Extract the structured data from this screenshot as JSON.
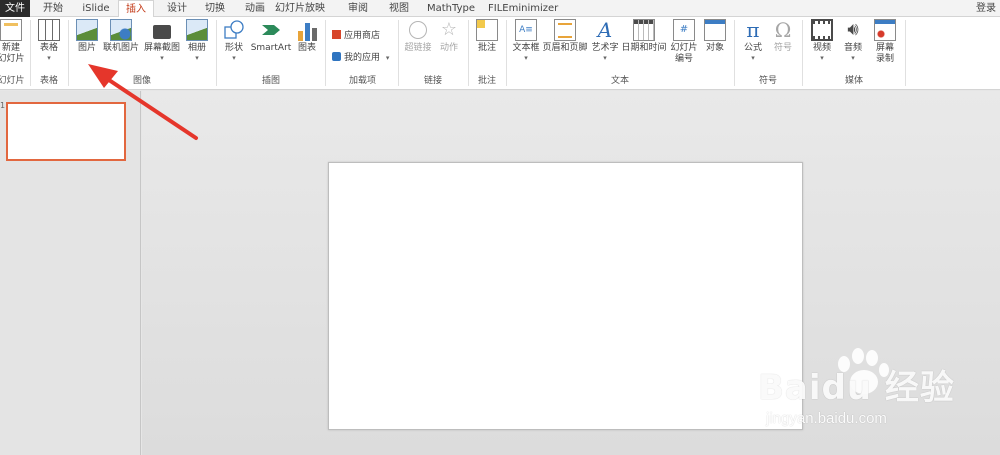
{
  "tabs": {
    "file": "文件",
    "items": [
      "开始",
      "iSlide",
      "插入",
      "设计",
      "切换",
      "动画",
      "幻灯片放映",
      "审阅",
      "视图",
      "MathType",
      "FILEminimizer"
    ],
    "active": "插入",
    "login": "登录"
  },
  "ribbon": {
    "slides": {
      "new_slide": "新建",
      "new_slide2": "幻灯片",
      "group": "幻灯片"
    },
    "tables": {
      "table": "表格",
      "group": "表格"
    },
    "images": {
      "picture": "图片",
      "online_picture": "联机图片",
      "screenshot": "屏幕截图",
      "album": "相册",
      "group": "图像"
    },
    "illustrations": {
      "shapes": "形状",
      "smartart": "SmartArt",
      "chart": "图表",
      "group": "插图"
    },
    "addins": {
      "store": "应用商店",
      "my_apps": "我的应用",
      "group": "加载项"
    },
    "links": {
      "hyperlink": "超链接",
      "action": "动作",
      "group": "链接"
    },
    "comments": {
      "comment": "批注",
      "group": "批注"
    },
    "text": {
      "textbox": "文本框",
      "header_footer": "页眉和页脚",
      "wordart": "艺术字",
      "datetime": "日期和时间",
      "slide_number": "幻灯片",
      "slide_number2": "编号",
      "object": "对象",
      "group": "文本"
    },
    "symbols": {
      "equation": "公式",
      "symbol": "符号",
      "group": "符号"
    },
    "media": {
      "video": "视频",
      "audio": "音频",
      "screen_record": "屏幕",
      "screen_record2": "录制",
      "group": "媒体"
    }
  },
  "panel": {
    "slide_number": "1"
  },
  "watermark": {
    "logo": "Baidu 经验",
    "url": "jingyan.baidu.com"
  },
  "colors": {
    "accent": "#c43e1c",
    "thumb_border": "#e2673f",
    "arrow": "#e5362b",
    "file_tab": "#2b2b2b"
  }
}
